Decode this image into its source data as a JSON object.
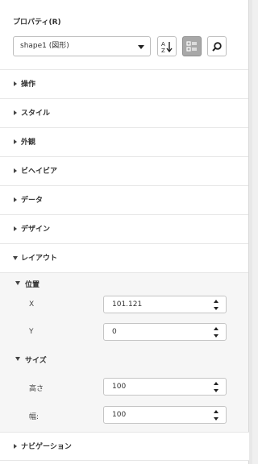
{
  "panel": {
    "title": "プロパティ(R)",
    "object_select": {
      "value": "shape1 (図形)"
    },
    "toolbar": {
      "sort_icon_text": "A↓Z",
      "categorized_icon": "categorized-view-icon",
      "search_icon": "search-icon"
    },
    "sections": [
      {
        "label": "操作"
      },
      {
        "label": "スタイル"
      },
      {
        "label": "外観"
      },
      {
        "label": "ビヘイビア"
      },
      {
        "label": "データ"
      },
      {
        "label": "デザイン"
      },
      {
        "label": "レイアウト"
      }
    ],
    "layout": {
      "position": {
        "label": "位置",
        "x_label": "X",
        "x_value": "101.121",
        "y_label": "Y",
        "y_value": "0"
      },
      "size": {
        "label": "サイズ",
        "height_label": "高さ",
        "height_value": "100",
        "width_label": "幅:",
        "width_value": "100"
      }
    },
    "navigation": {
      "label": "ナビゲーション"
    }
  }
}
